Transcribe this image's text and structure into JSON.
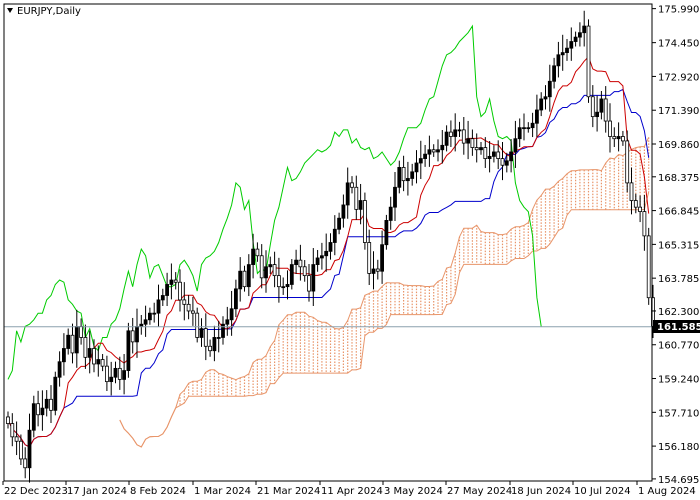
{
  "window": {
    "symbol_title": "EURJPY,Daily"
  },
  "colors": {
    "background": "#ffffff",
    "axis": "#000000",
    "bull_candle": "#000000",
    "bear_candle": "#ffffff",
    "tenkan": "#cc0000",
    "kijun": "#0000cc",
    "chikou": "#00cc00",
    "kumo_up": "#e8956a",
    "kumo_down": "#9999dd",
    "price_line": "#8ca0ad",
    "price_box": "#000000"
  },
  "chart_data": {
    "type": "candlestick",
    "indicator": "Ichimoku Kinko Hyo",
    "y_min": 154.6,
    "y_max": 176.2,
    "y_ticks": [
      "175.990",
      "174.450",
      "172.920",
      "171.390",
      "169.860",
      "168.375",
      "166.845",
      "165.315",
      "163.785",
      "162.300",
      "160.770",
      "159.240",
      "157.710",
      "156.180",
      "154.695"
    ],
    "y_tick_values": [
      175.99,
      174.45,
      172.92,
      171.39,
      169.86,
      168.375,
      166.845,
      165.315,
      163.785,
      162.3,
      160.77,
      159.24,
      157.71,
      156.18,
      154.695
    ],
    "x_ticks": [
      "22 Dec 2023",
      "17 Jan 2024",
      "8 Feb 2024",
      "1 Mar 2024",
      "21 Mar 2024",
      "11 Apr 2024",
      "3 May 2024",
      "27 May 2024",
      "18 Jun 2024",
      "10 Jul 2024",
      "1 Aug 2024"
    ],
    "current_price": "161.585",
    "current_price_value": 161.585,
    "ohlc_close": [
      157.2,
      156.6,
      156.4,
      155.6,
      155.2,
      156.9,
      158.1,
      157.6,
      157.9,
      158.3,
      157.8,
      159.3,
      160.0,
      160.6,
      161.2,
      160.4,
      161.6,
      161.1,
      160.2,
      160.6,
      159.9,
      160.1,
      159.8,
      159.1,
      159.3,
      159.7,
      159.2,
      159.6,
      161.4,
      160.9,
      161.6,
      161.7,
      161.9,
      162.2,
      162.2,
      162.8,
      163.0,
      163.5,
      163.7,
      163.6,
      162.8,
      162.6,
      162.3,
      162.2,
      161.1,
      161.5,
      160.7,
      160.5,
      161.1,
      161.1,
      161.7,
      161.9,
      162.4,
      163.3,
      164.1,
      163.4,
      164.4,
      165.1,
      164.8,
      163.8,
      164.3,
      164.4,
      163.9,
      163.4,
      163.4,
      163.5,
      164.4,
      164.6,
      164.3,
      163.9,
      163.2,
      164.4,
      164.7,
      164.8,
      165.0,
      165.4,
      166.0,
      166.5,
      167.1,
      168.1,
      167.9,
      166.9,
      167.3,
      165.4,
      164.0,
      164.2,
      164.1,
      165.3,
      166.4,
      167.0,
      167.9,
      168.8,
      168.2,
      168.3,
      168.6,
      169.0,
      169.2,
      169.4,
      169.6,
      169.5,
      169.6,
      169.8,
      170.4,
      170.2,
      170.5,
      170.5,
      169.9,
      170.1,
      169.7,
      169.6,
      169.7,
      169.2,
      169.3,
      169.5,
      169.2,
      168.9,
      169.1,
      169.5,
      170.1,
      170.6,
      170.6,
      170.6,
      170.8,
      171.4,
      171.9,
      172.0,
      172.7,
      173.4,
      173.9,
      174.0,
      174.2,
      174.5,
      174.7,
      174.9,
      175.2,
      172.0,
      171.1,
      171.3,
      171.9,
      170.9,
      170.2,
      170.1,
      170.2,
      170.0,
      168.1,
      167.3,
      167.0,
      166.8,
      165.7,
      162.9,
      161.6
    ],
    "kumo_x_shift_bars": 26
  }
}
